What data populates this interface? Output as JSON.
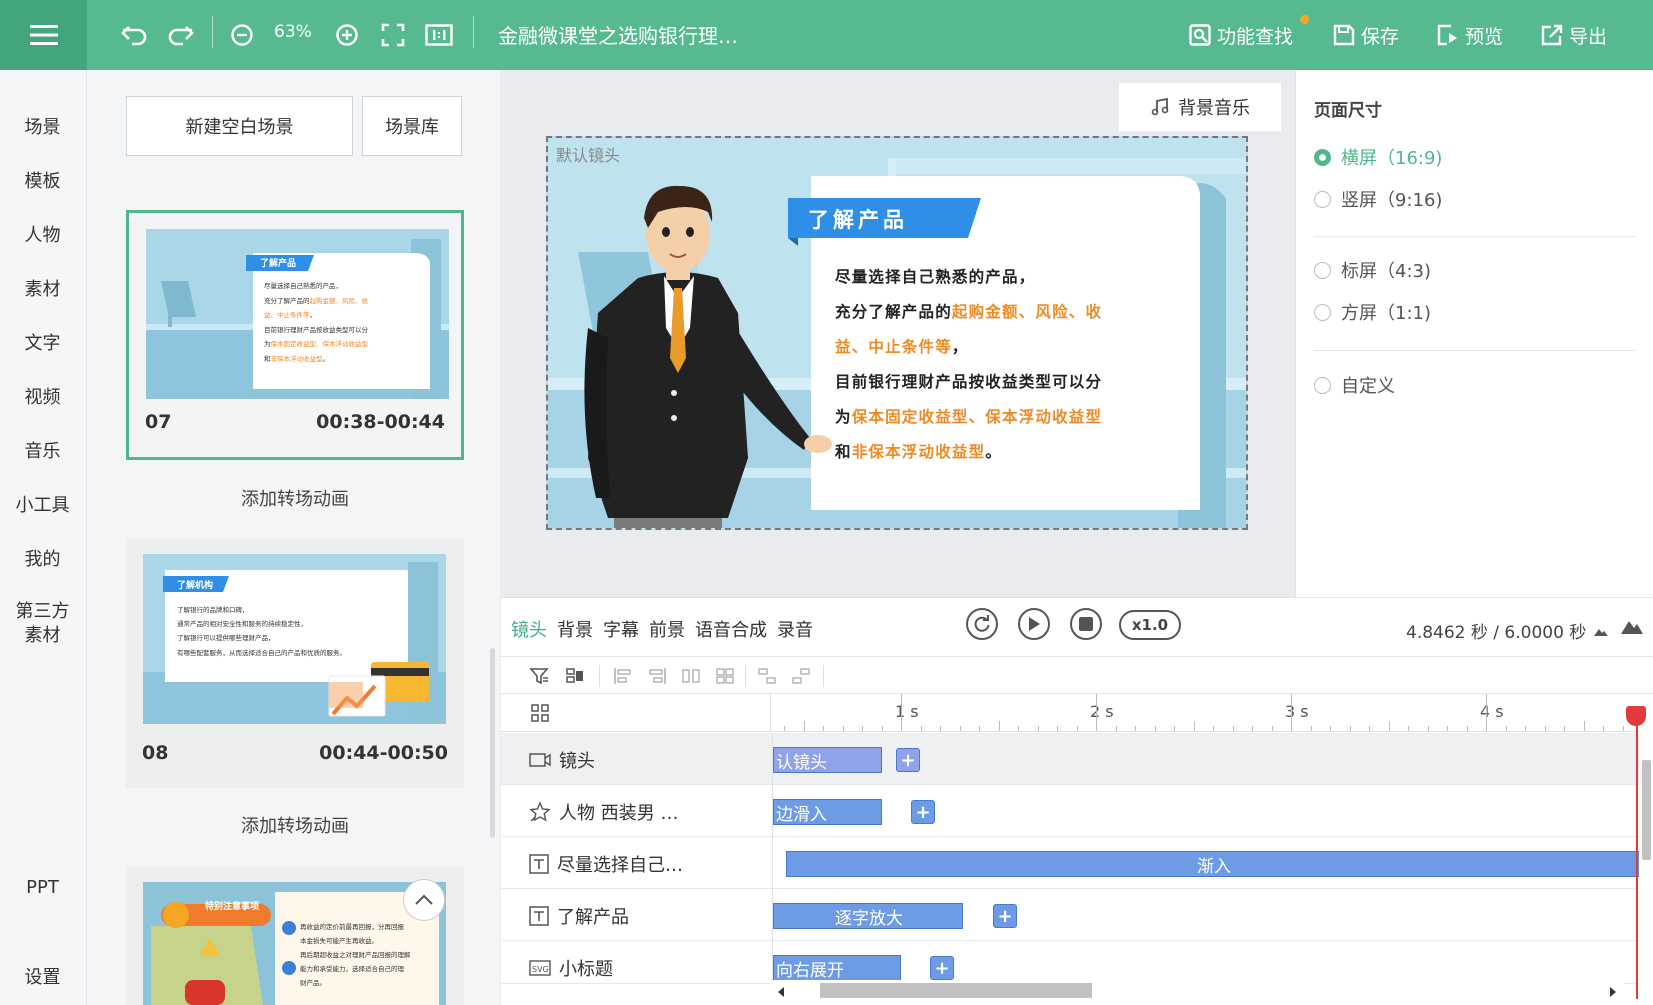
{
  "topbar": {
    "zoom": "63%",
    "doc_title": "金融微课堂之选购银行理…",
    "find": "功能查找",
    "save": "保存",
    "preview": "预览",
    "export": "导出"
  },
  "nav": [
    "场景",
    "模板",
    "人物",
    "素材",
    "文字",
    "视频",
    "音乐",
    "小工具",
    "我的",
    "第三方素材"
  ],
  "nav_bottom": {
    "ppt": "PPT",
    "settings": "设置"
  },
  "scenes_panel": {
    "new_blank": "新建空白场景",
    "library": "场景库",
    "scenes": [
      {
        "num": "07",
        "time": "00:38-00:44",
        "thumb_title": "了解产品",
        "selected": true
      },
      {
        "num": "08",
        "time": "00:44-00:50",
        "thumb_title": "了解机构",
        "selected": false
      },
      {
        "thumb_title": "特别注意事项"
      }
    ],
    "add_transition": "添加转场动画",
    "thumb07_lines": [
      {
        "parts": [
          {
            "t": "尽量选择自己熟悉的产品，"
          }
        ]
      },
      {
        "parts": [
          {
            "t": "充分了解产品的"
          },
          {
            "t": "起购金额、风险、收",
            "hl": true
          }
        ]
      },
      {
        "parts": [
          {
            "t": "益、中止条件等",
            "hl": true
          },
          {
            "t": "，"
          }
        ]
      },
      {
        "parts": [
          {
            "t": "目前银行理财产品按收益类型可以分"
          }
        ]
      },
      {
        "parts": [
          {
            "t": "为"
          },
          {
            "t": "保本固定收益型、保本浮动收益型",
            "hl": true
          }
        ]
      },
      {
        "parts": [
          {
            "t": "和"
          },
          {
            "t": "非保本浮动收益型",
            "hl": true
          },
          {
            "t": "。"
          }
        ]
      }
    ],
    "thumb08_lines": [
      "了解银行的品牌和口碑，",
      "通常产品的相对安全性和服务的持续稳定性，",
      "了解银行可以提供哪些理财产品，",
      "有哪些配套服务，从而选择适合自己的产品和优质的服务。"
    ],
    "thumb09_lines": [
      "再收益的定价前最再回报，分再回报",
      "本金损失可能产生再收益。",
      "再后期超收益之对理财产品回报的理解",
      "能力和承受能力，选择适合自己的理",
      "财产品。"
    ]
  },
  "canvas": {
    "bgm": "背景音乐",
    "camera_label": "默认镜头",
    "card_title": "了解产品",
    "card_lines": [
      {
        "parts": [
          {
            "t": "尽量选择自己熟悉的产品，"
          }
        ]
      },
      {
        "parts": [
          {
            "t": "充分了解产品的"
          },
          {
            "t": "起购金额、风险、收",
            "hl": true
          }
        ]
      },
      {
        "parts": [
          {
            "t": "益、中止条件等",
            "hl": true
          },
          {
            "t": "，"
          }
        ]
      },
      {
        "parts": [
          {
            "t": "目前银行理财产品按收益类型可以分"
          }
        ]
      },
      {
        "parts": [
          {
            "t": "为"
          },
          {
            "t": "保本固定收益型、保本浮动收益型",
            "hl": true
          }
        ]
      },
      {
        "parts": [
          {
            "t": "和"
          },
          {
            "t": "非保本浮动收益型",
            "hl": true
          },
          {
            "t": "。"
          }
        ]
      }
    ]
  },
  "page_size": {
    "title": "页面尺寸",
    "options": [
      {
        "label": "横屏（16:9)",
        "checked": true
      },
      {
        "label": "竖屏（9:16)",
        "checked": false
      },
      {
        "label": "标屏（4:3)",
        "checked": false
      },
      {
        "label": "方屏（1:1)",
        "checked": false
      },
      {
        "label": "自定义",
        "checked": false
      }
    ]
  },
  "timeline": {
    "tabs": [
      "镜头",
      "背景",
      "字幕",
      "前景",
      "语音合成",
      "录音"
    ],
    "active_tab": "镜头",
    "speed": "x1.0",
    "time": "4.8462 秒 / 6.0000 秒",
    "ruler_labels": [
      "1 s",
      "2 s",
      "3 s",
      "4 s"
    ],
    "tracks": [
      {
        "name": "镜头",
        "icon": "camera-icon",
        "clip": "认镜头"
      },
      {
        "name": "人物 西装男 …",
        "icon": "character-icon",
        "clip": "边滑入"
      },
      {
        "name": "尽量选择自己…",
        "icon": "text-icon",
        "clip": "渐入"
      },
      {
        "name": "了解产品",
        "icon": "text-icon",
        "clip": "逐字放大"
      },
      {
        "name": "小标题",
        "icon": "svg-icon",
        "clip": "向右展开"
      }
    ]
  },
  "colors": {
    "brand": "#56b98f",
    "accent": "#4fb88a",
    "clip": "#6e9be5",
    "highlight": "#f08a24",
    "title_blue": "#2f8fe6"
  }
}
